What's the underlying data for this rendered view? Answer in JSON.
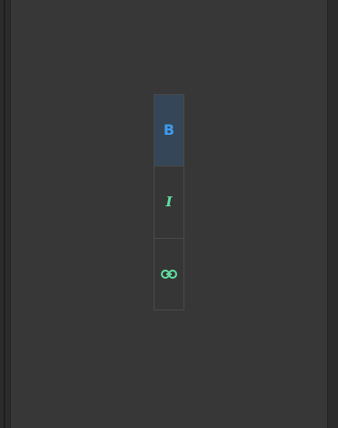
{
  "toolbar": {
    "buttons": [
      {
        "id": "bold",
        "label": "B",
        "icon": "bold-icon",
        "active": true,
        "color": "#3d9bf0"
      },
      {
        "id": "italic",
        "label": "I",
        "icon": "italic-icon",
        "active": false,
        "color": "#5fe0a0"
      },
      {
        "id": "link",
        "label": "",
        "icon": "link-icon",
        "active": false,
        "color": "#5fe0a0"
      }
    ]
  },
  "colors": {
    "background": "#373737",
    "active_button_bg": "#344657",
    "border": "#4a4a4a"
  }
}
